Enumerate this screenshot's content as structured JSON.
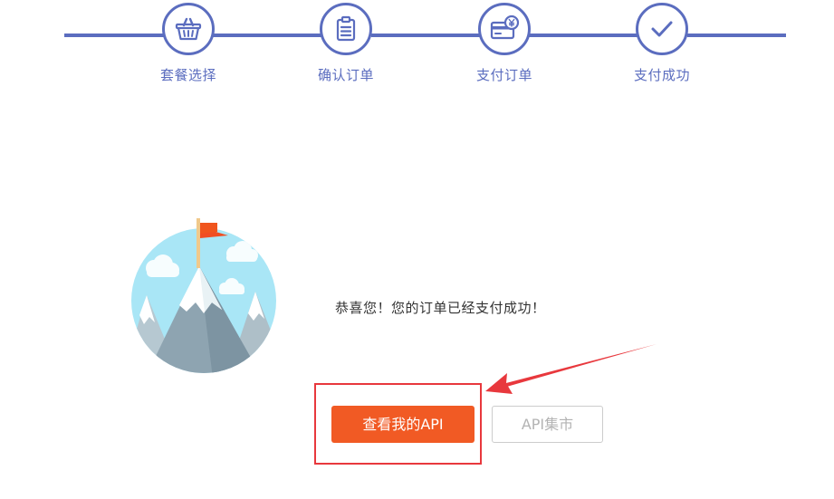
{
  "stepper": {
    "steps": [
      {
        "label": "套餐选择",
        "icon": "basket-icon"
      },
      {
        "label": "确认订单",
        "icon": "clipboard-icon"
      },
      {
        "label": "支付订单",
        "icon": "credit-card-icon"
      },
      {
        "label": "支付成功",
        "icon": "checkmark-icon"
      }
    ],
    "current_step": 4
  },
  "illustration": {
    "icon": "mountain-flag-icon"
  },
  "message": {
    "text": "恭喜您！您的订单已经支付成功！"
  },
  "actions": {
    "primary_label": "查看我的API",
    "secondary_label": "API集市"
  },
  "colors": {
    "stepper": "#5b6dbf",
    "primary_button": "#f15a24",
    "annotation": "#e8383d"
  }
}
